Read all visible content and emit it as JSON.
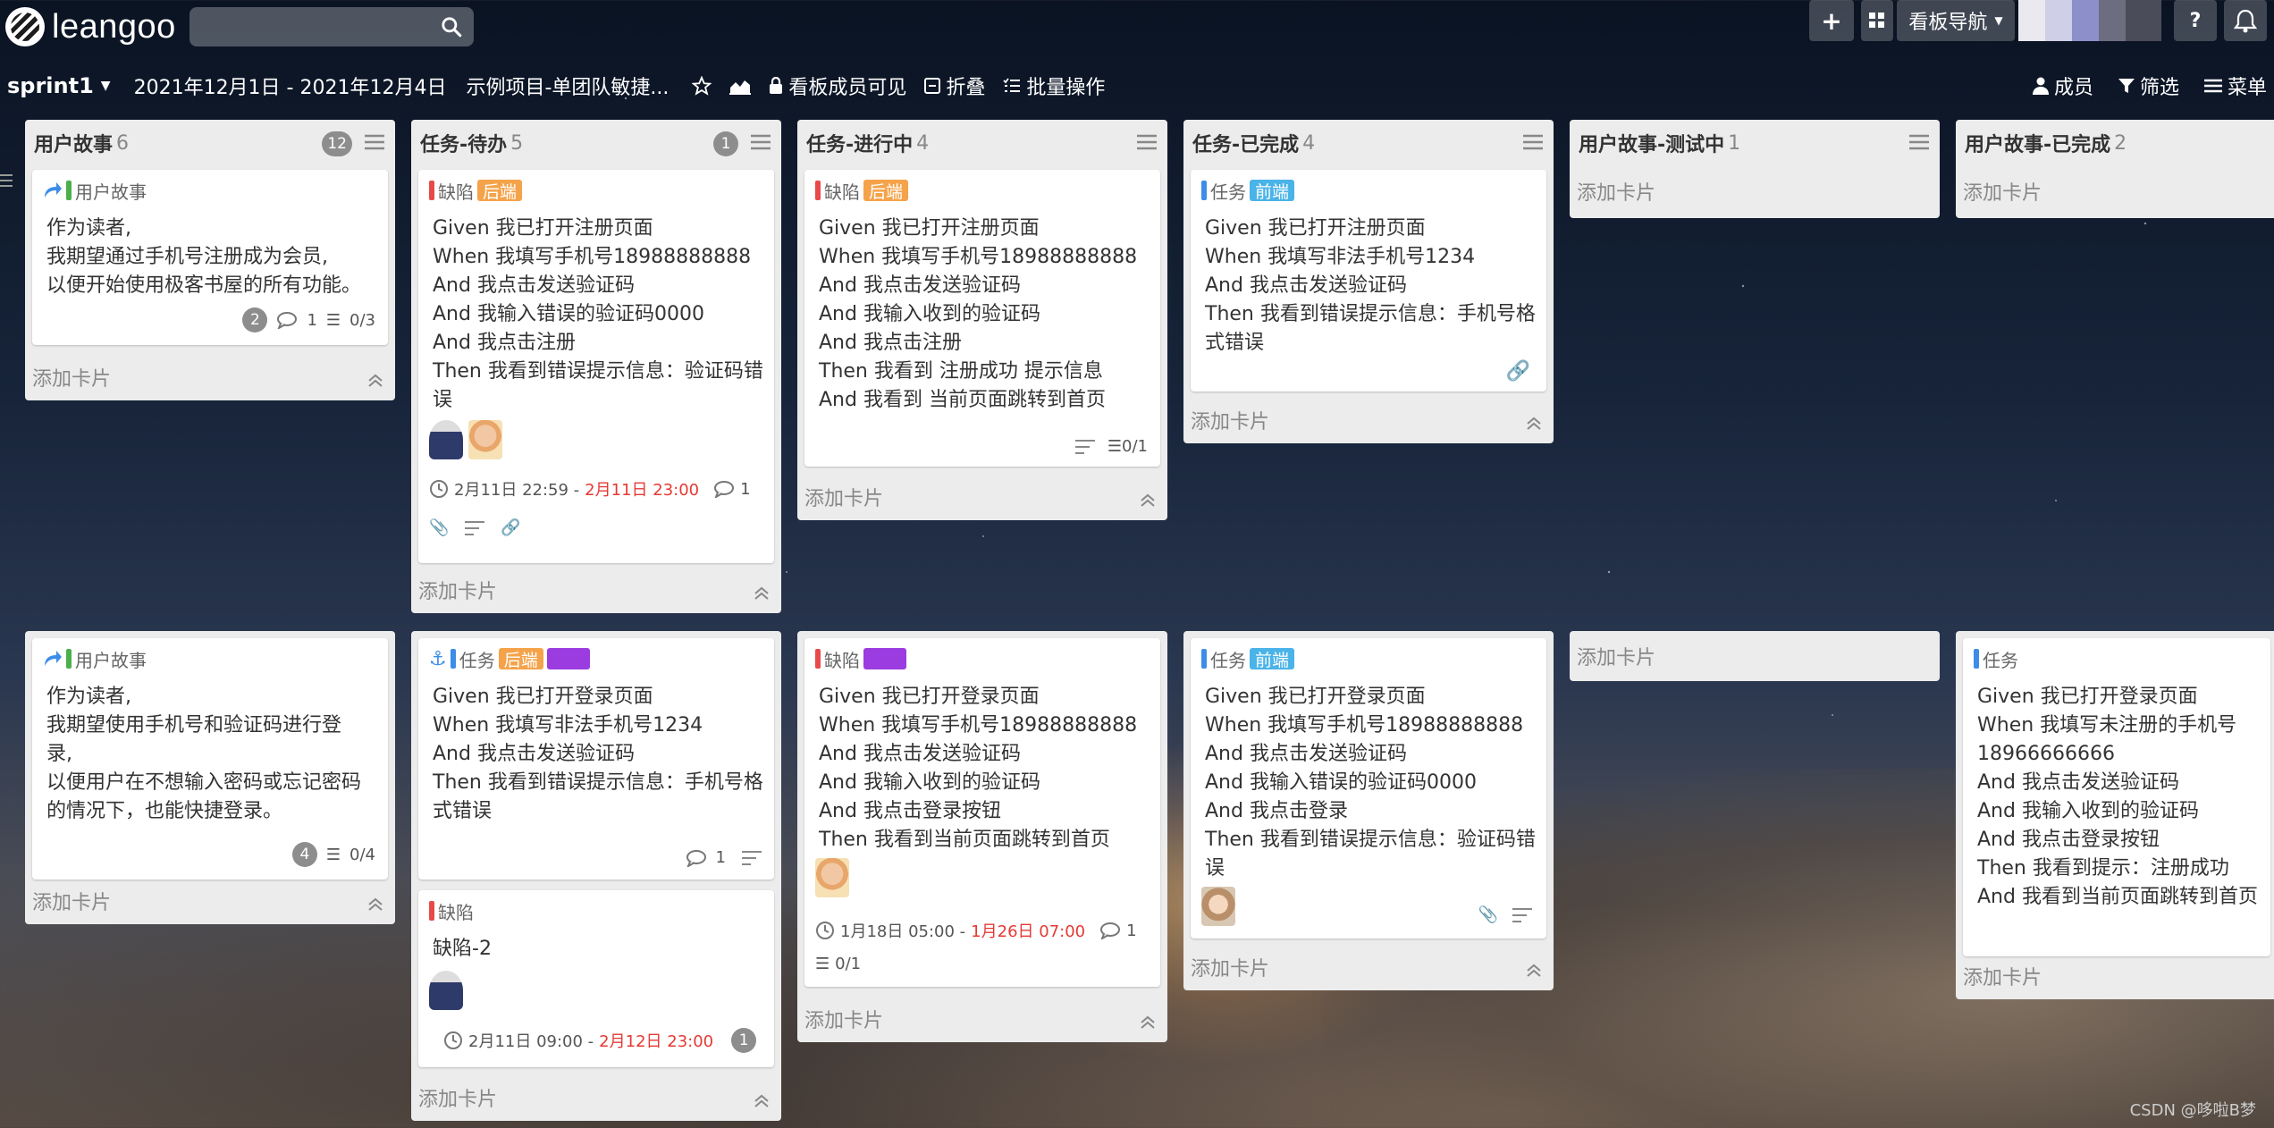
{
  "topbar": {
    "logo_text": "leangoo",
    "search_placeholder": "",
    "add_label": "+",
    "board_nav_label": "看板导航",
    "help_label": "?"
  },
  "header": {
    "sprint": "sprint1",
    "dates": "2021年12月1日 - 2021年12月4日",
    "project": "示例项目-单团队敏捷...",
    "visibility": "看板成员可见",
    "fold": "折叠",
    "batch": "批量操作",
    "members": "成员",
    "filter": "筛选",
    "menu": "菜单"
  },
  "columns": [
    {
      "title": "用户故事",
      "count": "6",
      "badge": "12",
      "add": "添加卡片"
    },
    {
      "title": "任务-待办",
      "count": "5",
      "badge": "1",
      "add": "添加卡片"
    },
    {
      "title": "任务-进行中",
      "count": "4",
      "add": "添加卡片"
    },
    {
      "title": "任务-已完成",
      "count": "4",
      "add": "添加卡片"
    },
    {
      "title": "用户故事-测试中",
      "count": "1",
      "add": "添加卡片"
    },
    {
      "title": "用户故事-已完成",
      "count": "2",
      "add": "添加卡片"
    }
  ],
  "row2": {
    "c0_add": "添加卡片",
    "c1_add": "添加卡片",
    "c2_add": "添加卡片",
    "c3_add": "添加卡片",
    "c4_add": "添加卡片",
    "c5_add": "添加卡片"
  },
  "cards": {
    "us1": {
      "type": "用户故事",
      "lines": [
        "作为读者,",
        "我期望通过手机号注册成为会员,",
        "以便开始使用极客书屋的所有功能。"
      ],
      "badge": "2",
      "comments": "1",
      "checklist": "0/3"
    },
    "todo1": {
      "type": "缺陷",
      "label": "后端",
      "lines": [
        "Given 我已打开注册页面",
        "When 我填写手机号18988888888",
        "And 我点击发送验证码",
        "And 我输入错误的验证码0000",
        "And 我点击注册",
        "Then 我看到错误提示信息：验证码错",
        "误"
      ],
      "date_start": "2月11日 22:59 - ",
      "date_end": "2月11日 23:00",
      "comments": "1"
    },
    "prog1": {
      "type": "缺陷",
      "label": "后端",
      "lines": [
        "Given 我已打开注册页面",
        "When 我填写手机号18988888888",
        "And 我点击发送验证码",
        "And 我输入收到的验证码",
        "And 我点击注册",
        "Then 我看到 注册成功 提示信息",
        "And 我看到 当前页面跳转到首页"
      ],
      "checklist": "0/1"
    },
    "done1": {
      "type": "任务",
      "label": "前端",
      "lines": [
        "Given 我已打开注册页面",
        "When 我填写非法手机号1234",
        "And 我点击发送验证码",
        "Then 我看到错误提示信息：手机号格",
        "式错误"
      ]
    },
    "us2": {
      "type": "用户故事",
      "lines": [
        "作为读者,",
        "我期望使用手机号和验证码进行登",
        "录,",
        "以便用户在不想输入密码或忘记密码",
        "的情况下，也能快捷登录。"
      ],
      "badge": "4",
      "checklist": "0/4"
    },
    "todo2": {
      "type": "任务",
      "label": "后端",
      "lines": [
        "Given 我已打开登录页面",
        "When 我填写非法手机号1234",
        "And 我点击发送验证码",
        "Then 我看到错误提示信息：手机号格",
        "式错误"
      ],
      "comments": "1"
    },
    "todo3": {
      "type": "缺陷",
      "lines": [
        "缺陷-2"
      ],
      "date_start": "2月11日 09:00 - ",
      "date_end": "2月12日 23:00",
      "badge": "1"
    },
    "prog2": {
      "type": "缺陷",
      "lines": [
        "Given 我已打开登录页面",
        "When 我填写手机号18988888888",
        "And 我点击发送验证码",
        "And 我输入收到的验证码",
        "And 我点击登录按钮",
        "Then 我看到当前页面跳转到首页"
      ],
      "date_start": "1月18日 05:00 - ",
      "date_end": "1月26日 07:00",
      "comments": "1",
      "checklist": "0/1"
    },
    "done2": {
      "type": "任务",
      "label": "前端",
      "lines": [
        "Given 我已打开登录页面",
        "When 我填写手机号18988888888",
        "And 我点击发送验证码",
        "And 我输入错误的验证码0000",
        "And 我点击登录",
        "Then 我看到错误提示信息：验证码错",
        "误"
      ]
    },
    "ucdone1": {
      "type": "任务",
      "lines": [
        "Given 我已打开登录页面",
        "When 我填写未注册的手机号",
        "18966666666",
        "And 我点击发送验证码",
        "And 我输入收到的验证码",
        "And 我点击登录按钮",
        "Then 我看到提示：注册成功",
        "And 我看到当前页面跳转到首页"
      ]
    }
  },
  "watermark": "CSDN @哆啦B梦"
}
